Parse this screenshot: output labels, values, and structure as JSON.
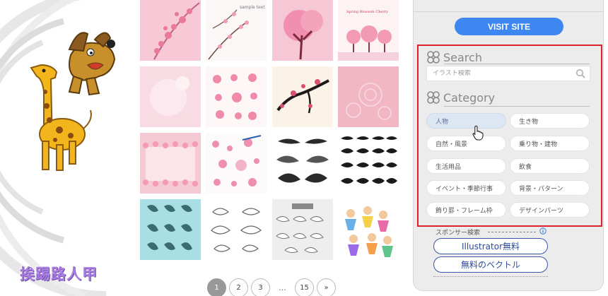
{
  "sidebar": {
    "visit_label": "VISIT SITE",
    "search": {
      "title": "Search",
      "placeholder": "イラスト検索"
    },
    "category": {
      "title": "Category",
      "items": [
        {
          "label": "人物"
        },
        {
          "label": "生き物"
        },
        {
          "label": "自然・風景"
        },
        {
          "label": "乗り物・建物"
        },
        {
          "label": "生活用品"
        },
        {
          "label": "飲食"
        },
        {
          "label": "イベント・季節行事"
        },
        {
          "label": "背景・パターン"
        },
        {
          "label": "飾り罫・フレーム枠"
        },
        {
          "label": "デザインパーツ"
        }
      ]
    },
    "sponsor": {
      "label": "スポンサー検索",
      "buttons": [
        {
          "label": "Illustrator無料"
        },
        {
          "label": "無料のベクトル"
        }
      ]
    }
  },
  "pagination": {
    "pages": [
      "1",
      "2",
      "3"
    ],
    "ellipsis": "...",
    "last": "15",
    "next": "»"
  },
  "thumbnails": {
    "t2_text": "sample text",
    "t4_text": "Spring Blossom Cherry"
  },
  "watermark": "挨踢路人甲",
  "colors": {
    "accent": "#3e87f0",
    "highlight": "#e01f2a",
    "pink": "#f4b8c8"
  }
}
